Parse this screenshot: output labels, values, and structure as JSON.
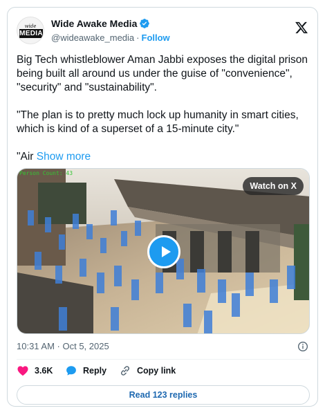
{
  "author": {
    "name": "Wide Awake Media",
    "handle": "@wideawake_media",
    "separator": "·",
    "follow_label": "Follow",
    "avatar_top": "wide awake",
    "avatar_box": "MEDIA"
  },
  "tweet": {
    "paragraph1": "Big Tech whistleblower Aman Jabbi exposes the digital prison being built all around us under the guise of \"convenience\", \"security\" and \"sustainability\".",
    "paragraph2": "\"The plan is to pretty much lock up humanity in smart cities, which is kind of a superset of a 15-minute city.\"",
    "paragraph3_start": "\"Air ",
    "show_more": "Show more"
  },
  "media": {
    "watch_label": "Watch on X",
    "count_label": "Person Count: 43"
  },
  "timestamp": "10:31 AM · Oct 5, 2025",
  "actions": {
    "likes": "3.6K",
    "reply": "Reply",
    "copy_link": "Copy link"
  },
  "read_replies": "Read 123 replies",
  "colors": {
    "accent": "#1d9bf0",
    "like": "#f91880",
    "text": "#0f1419",
    "muted": "#536471"
  }
}
